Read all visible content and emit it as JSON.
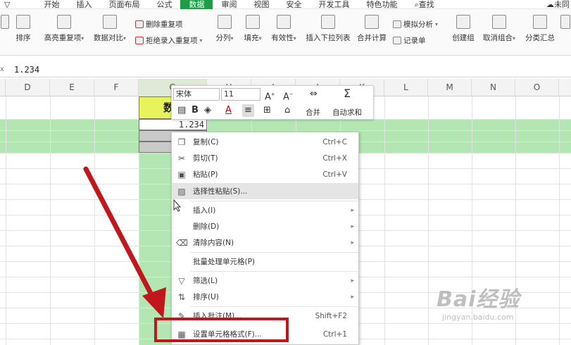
{
  "menubar": {
    "items": [
      "开始",
      "插入",
      "页面布局",
      "公式",
      "数据",
      "审阅",
      "视图",
      "安全",
      "开发工具",
      "特色功能"
    ],
    "active": "数据",
    "search": "查找",
    "user": "未同"
  },
  "ribbon": {
    "sort_label": "排序",
    "highlight_dup": "高亮重复项",
    "compare": "数据对比",
    "delete_dup": "删除重复项",
    "reject_dup": "拒绝录入重复项",
    "split": "分列",
    "fill": "填充",
    "validity": "有效性",
    "dropdown": "插入下拉列表",
    "consolidate": "合并计算",
    "whatif": "模拟分析",
    "record": "记录单",
    "group": "创建组",
    "ungroup": "取消组合",
    "subtotal": "分类汇总"
  },
  "formula_bar": {
    "value": "1.234"
  },
  "columns": [
    "D",
    "E",
    "F",
    "G",
    "H",
    "I",
    "J",
    "K",
    "L",
    "M",
    "N",
    "O"
  ],
  "cells": {
    "header_text": "数",
    "c1_value": "1.234"
  },
  "mini_toolbar": {
    "font_name": "宋体",
    "font_size": "11",
    "bold": "B",
    "merge_label": "合并",
    "autosum_label": "自动求和"
  },
  "context_menu": {
    "items": [
      {
        "label": "复制(C)",
        "shortcut": "Ctrl+C",
        "icon": "copy-icon"
      },
      {
        "label": "剪切(T)",
        "shortcut": "Ctrl+X",
        "icon": "scissors-icon"
      },
      {
        "label": "粘贴(P)",
        "shortcut": "Ctrl+V",
        "icon": "paste-icon"
      },
      {
        "label": "选择性粘贴(S)...",
        "shortcut": "",
        "icon": "paste-special-icon"
      },
      {
        "label": "插入(I)",
        "shortcut": "",
        "icon": ""
      },
      {
        "label": "删除(D)",
        "shortcut": "",
        "icon": ""
      },
      {
        "label": "清除内容(N)",
        "shortcut": "",
        "icon": "eraser-icon"
      },
      {
        "label": "批量处理单元格(P)",
        "shortcut": "",
        "icon": ""
      },
      {
        "label": "筛选(L)",
        "shortcut": "",
        "icon": "filter-icon"
      },
      {
        "label": "排序(U)",
        "shortcut": "",
        "icon": "sort-icon"
      },
      {
        "label": "插入批注(M)...",
        "shortcut": "Shift+F2",
        "icon": "comment-icon"
      },
      {
        "label": "设置单元格格式(F)...",
        "shortcut": "Ctrl+1",
        "icon": "format-cells-icon"
      }
    ]
  },
  "watermark": {
    "brand": "Bai经验",
    "url": "jingyan.baidu.com"
  },
  "colors": {
    "active_tab": "#1e9c4a",
    "row_highlight": "#b3e6b3",
    "header_cell": "#e8f25a",
    "annotation_red": "#c0171c"
  }
}
